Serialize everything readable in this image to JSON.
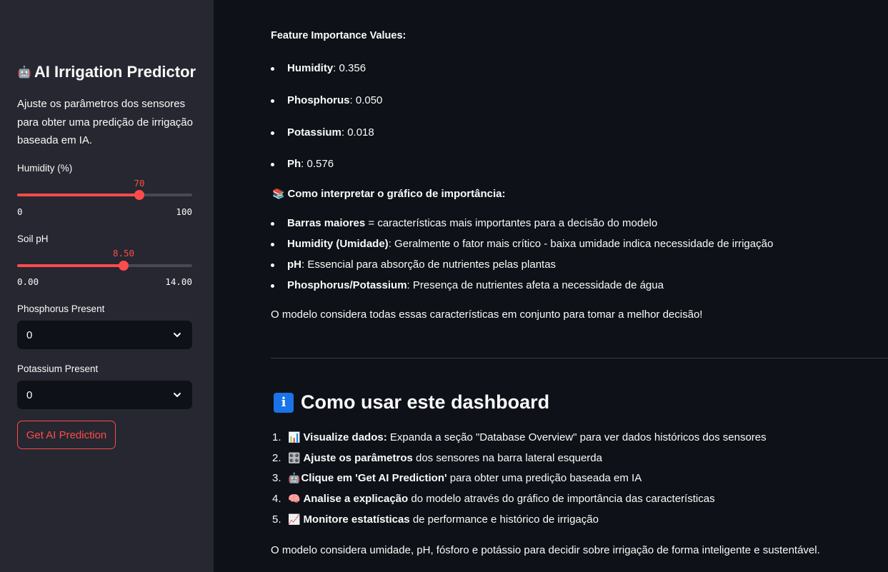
{
  "sidebar": {
    "title_icon": "🤖",
    "title": "AI Irrigation Predictor",
    "description": "Ajuste os parâmetros dos sensores para obter uma predição de irrigação baseada em IA.",
    "humidity": {
      "label": "Humidity (%)",
      "value": "70",
      "min": "0",
      "max": "100",
      "fraction": 0.7
    },
    "ph": {
      "label": "Soil pH",
      "value": "8.50",
      "min": "0.00",
      "max": "14.00",
      "fraction": 0.607
    },
    "phosphorus": {
      "label": "Phosphorus Present",
      "value": "0"
    },
    "potassium": {
      "label": "Potassium Present",
      "value": "0"
    },
    "button": "Get AI Prediction"
  },
  "main": {
    "fi_heading": "Feature Importance Values:",
    "fi": [
      {
        "name": "Humidity",
        "value": ": 0.356"
      },
      {
        "name": "Phosphorus",
        "value": ": 0.050"
      },
      {
        "name": "Potassium",
        "value": ": 0.018"
      },
      {
        "name": "Ph",
        "value": ": 0.576"
      }
    ],
    "interp_icon": "📚",
    "interp_heading": "Como interpretar o gráfico de importância:",
    "interp": [
      {
        "bold": "Barras maiores",
        "rest": " = características mais importantes para a decisão do modelo"
      },
      {
        "bold": "Humidity (Umidade)",
        "rest": ": Geralmente o fator mais crítico - baixa umidade indica necessidade de irrigação"
      },
      {
        "bold": "pH",
        "rest": ": Essencial para absorção de nutrientes pelas plantas"
      },
      {
        "bold": "Phosphorus/Potassium",
        "rest": ": Presença de nutrientes afeta a necessidade de água"
      }
    ],
    "conclusion": "O modelo considera todas essas características em conjunto para tomar a melhor decisão!",
    "howto_icon": "i",
    "howto_title": "Como usar este dashboard",
    "steps": [
      {
        "n": "1.",
        "icon": "📊",
        "bold": "Visualize dados:",
        "rest": " Expanda a seção \"Database Overview\" para ver dados históricos dos sensores"
      },
      {
        "n": "2.",
        "icon": "🎛️",
        "bold": "Ajuste os parâmetros",
        "rest": " dos sensores na barra lateral esquerda"
      },
      {
        "n": "3.",
        "icon": "🤖",
        "bold": "Clique em 'Get AI Prediction'",
        "rest": " para obter uma predição baseada em IA"
      },
      {
        "n": "4.",
        "icon": "🧠",
        "bold": "Analise a explicação",
        "rest": " do modelo através do gráfico de importância das características"
      },
      {
        "n": "5.",
        "icon": "📈",
        "bold": "Monitore estatísticas",
        "rest": " de performance e histórico de irrigação"
      }
    ],
    "footer": "O modelo considera umidade, pH, fósforo e potássio para decidir sobre irrigação de forma inteligente e sustentável."
  }
}
